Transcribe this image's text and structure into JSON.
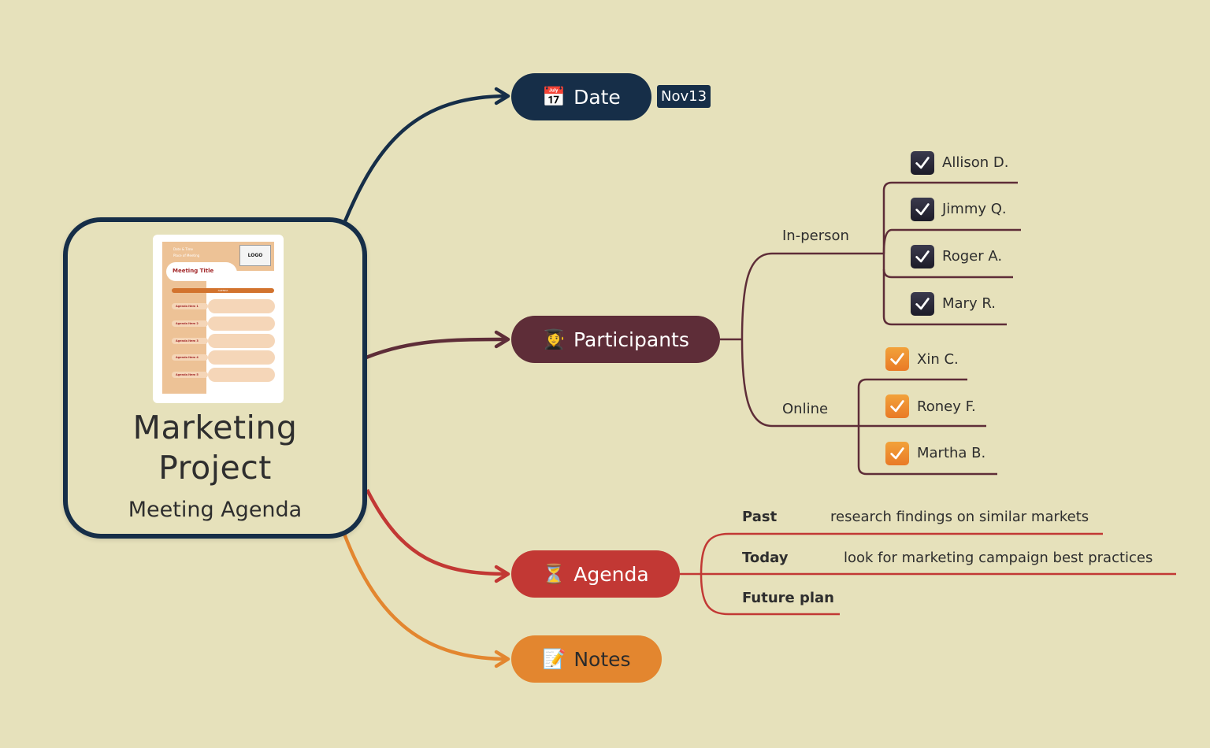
{
  "root": {
    "title_line1": "Marketing",
    "title_line2": "Project",
    "subtitle": "Meeting Agenda",
    "thumbnail": {
      "date_time": "Date & Time",
      "place": "Place of Meeting",
      "logo": "LOGO",
      "meeting_title": "Meeting Title",
      "agenda_header": "AGENDA",
      "items": [
        "Agenda Item 1",
        "Agenda Item 2",
        "Agenda Item 3",
        "Agenda Item 4",
        "Agenda Item 5"
      ]
    }
  },
  "topics": {
    "date": {
      "label": "Date",
      "icon": "calendar-icon",
      "emoji": "📅",
      "tag": "Nov13",
      "color": "#162e48"
    },
    "participants": {
      "label": "Participants",
      "icon": "student-icon",
      "emoji": "👩‍🎓",
      "color": "#5e2d38"
    },
    "agenda": {
      "label": "Agenda",
      "icon": "hourglass-icon",
      "emoji": "⏳",
      "color": "#c23834"
    },
    "notes": {
      "label": "Notes",
      "icon": "memo-icon",
      "emoji": "📝",
      "color": "#e3862f"
    }
  },
  "participants": {
    "in_person": {
      "label": "In-person",
      "people": [
        "Allison D.",
        "Jimmy Q.",
        "Roger A.",
        "Mary R."
      ],
      "checked": true,
      "check_color": "#2a2938"
    },
    "online": {
      "label": "Online",
      "people": [
        "Xin C.",
        "Roney F.",
        "Martha B."
      ],
      "checked": true,
      "check_color": "#ee8a2c"
    }
  },
  "agenda": {
    "items": [
      {
        "label": "Past",
        "detail": "research findings on similar markets"
      },
      {
        "label": "Today",
        "detail": "look for marketing campaign best practices"
      },
      {
        "label": "Future plan",
        "detail": ""
      }
    ]
  },
  "colors": {
    "background": "#e6e1bb",
    "text": "#2e2e2e"
  }
}
